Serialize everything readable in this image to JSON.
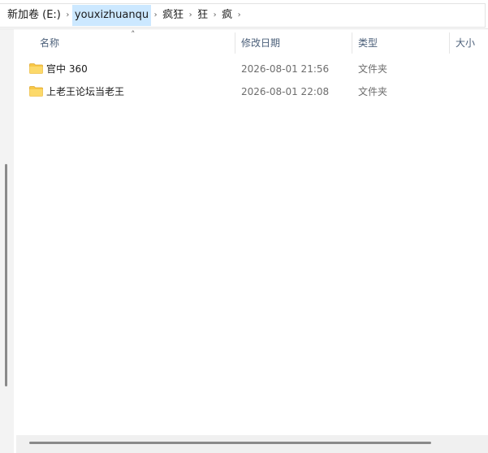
{
  "breadcrumb": {
    "items": [
      "新加卷 (E:)",
      "youxizhuanqu",
      "疯狂",
      "狂",
      "疯"
    ]
  },
  "columns": {
    "name": "名称",
    "modified": "修改日期",
    "type": "类型",
    "size": "大小"
  },
  "files": [
    {
      "name": "官中 360",
      "modified": "2026-08-01 21:56",
      "type": "文件夹"
    },
    {
      "name": "上老王论坛当老王",
      "modified": "2026-08-01 22:08",
      "type": "文件夹"
    }
  ],
  "colors": {
    "active_crumb": "#cce8ff",
    "folder": "#f8c847",
    "header_text": "#4c607a"
  }
}
